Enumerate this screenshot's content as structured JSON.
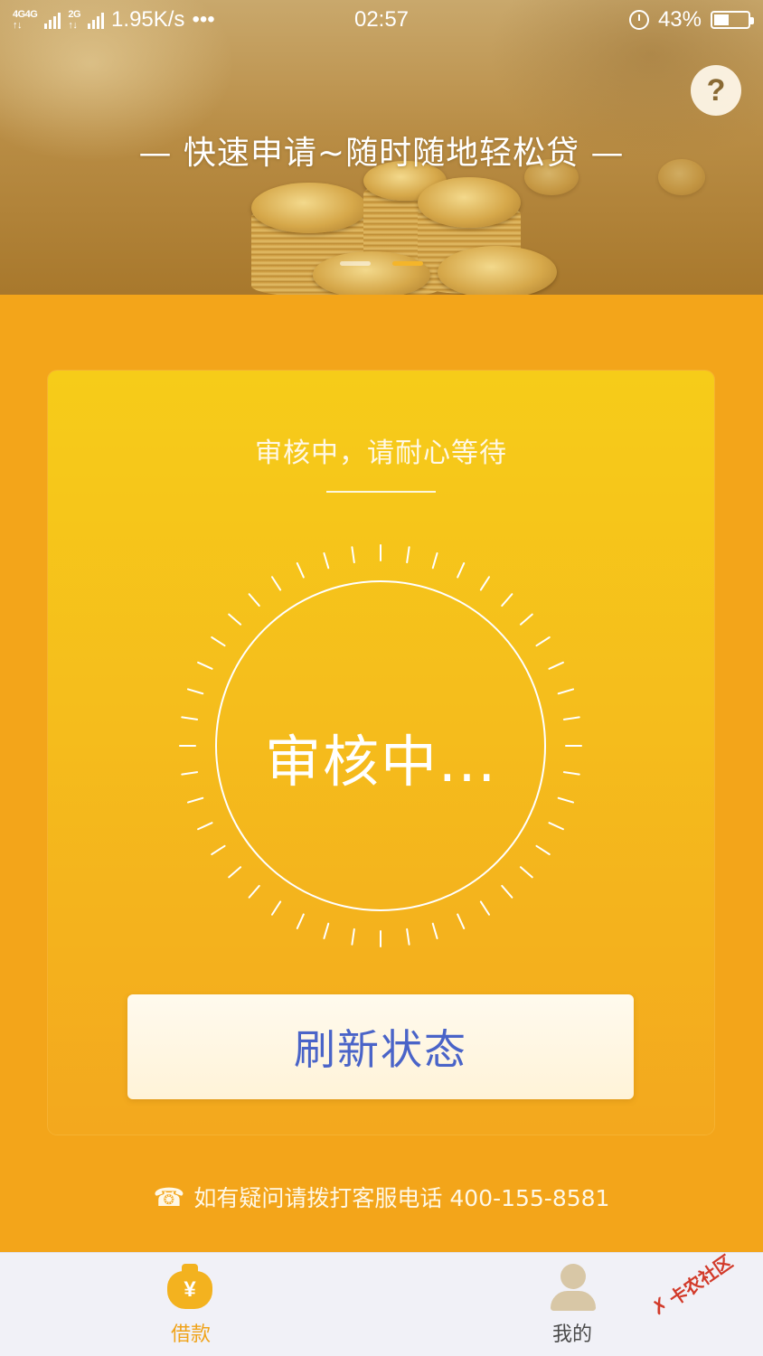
{
  "status_bar": {
    "network": "4G 4G 2G",
    "speed": "1.95K/s",
    "more": "•••",
    "time": "02:57",
    "battery": "43%"
  },
  "banner": {
    "slogan": "— 快速申请~随时随地轻松贷 —",
    "help": "?",
    "slides": 2,
    "active_slide": 2
  },
  "card": {
    "subtitle": "审核中，请耐心等待",
    "status": "审核中...",
    "refresh_label": "刷新状态"
  },
  "hotline": {
    "icon": "phone-icon",
    "text": "如有疑问请拨打客服电话 400-155-8581"
  },
  "nav": {
    "items": [
      {
        "label": "借款",
        "icon": "money-bag-icon",
        "active": true
      },
      {
        "label": "我的",
        "icon": "user-icon",
        "active": false
      }
    ]
  },
  "watermark": {
    "text": "卡农社区"
  },
  "colors": {
    "accent": "#f3a51a",
    "button_text": "#4a64c8",
    "nav_active": "#f0a31a",
    "nav_bg": "#f1f1f7"
  }
}
